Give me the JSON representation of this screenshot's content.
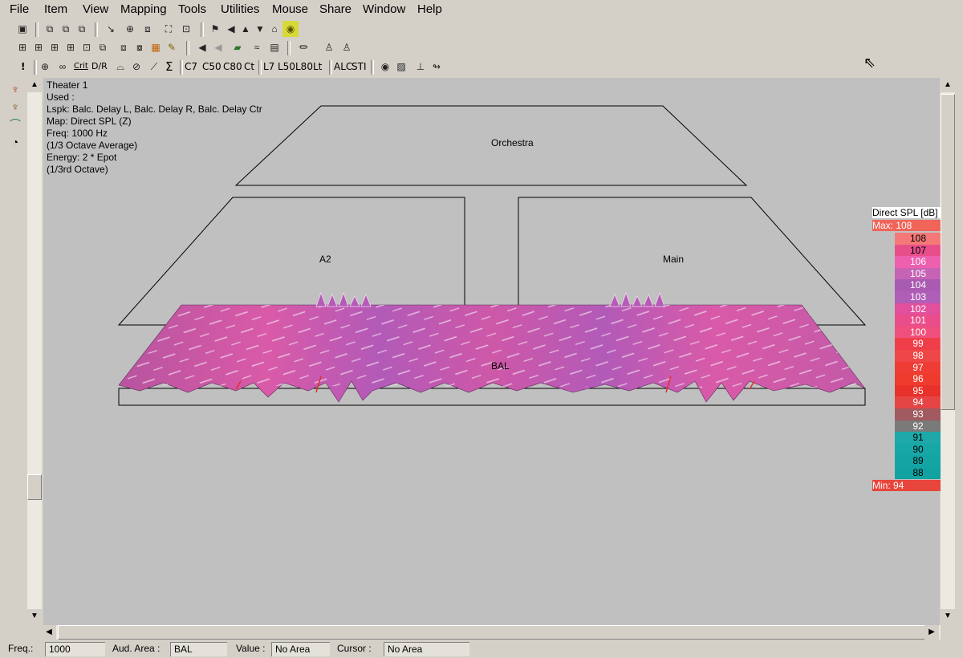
{
  "menu": [
    "File",
    "Item",
    "View",
    "Mapping",
    "Tools",
    "Utilities",
    "Mouse",
    "Share",
    "Window",
    "Help"
  ],
  "toolbar3_labels": [
    "!",
    "Σ",
    "C7",
    "C50",
    "C80",
    "Ct",
    "L7",
    "L50",
    "L80",
    "Lt",
    "ALC",
    "STI"
  ],
  "info": {
    "line1": "Theater 1",
    "line2": "Used :",
    "line3": "Lspk: Balc. Delay L, Balc. Delay R, Balc. Delay Ctr",
    "line4": "Map: Direct SPL (Z)",
    "line5": "Freq: 1000 Hz",
    "line6": "(1/3 Octave Average)",
    "line7": "Energy: 2 * Epot",
    "line8": "(1/3rd Octave)"
  },
  "regions": {
    "orchestra": "Orchestra",
    "a2": "A2",
    "main": "Main",
    "bal": "BAL"
  },
  "legend": {
    "title": "Direct SPL [dB]",
    "max_label": "Max: 108",
    "min_label": "Min: 94",
    "values": [
      "108",
      "107",
      "106",
      "105",
      "104",
      "103",
      "102",
      "101",
      "100",
      "99",
      "98",
      "97",
      "96",
      "95",
      "94",
      "93",
      "92",
      "91",
      "90",
      "89",
      "88"
    ],
    "colors": [
      "#f47878",
      "#e84f8a",
      "#ee5fae",
      "#c763b5",
      "#a95ab1",
      "#b05fb8",
      "#e24f9c",
      "#ea4d8a",
      "#ef4f7c",
      "#ef3e4a",
      "#ef4747",
      "#ef3c35",
      "#ef3b2e",
      "#e8312a",
      "#e64545",
      "#a05a60",
      "#7a7a7a",
      "#1ea8a8",
      "#16a8a6",
      "#14a4a4",
      "#12a2a2"
    ],
    "text_colors": [
      "#000",
      "#000",
      "#fff",
      "#fff",
      "#fff",
      "#fff",
      "#fff",
      "#fff",
      "#fff",
      "#fff",
      "#fff",
      "#fff",
      "#fff",
      "#fff",
      "#fff",
      "#fff",
      "#fff",
      "#000",
      "#000",
      "#000",
      "#000"
    ]
  },
  "status": {
    "freq_label": "Freq.:",
    "freq_value": "1000",
    "area_label": "Aud. Area :",
    "area_value": "BAL",
    "value_label": "Value :",
    "value_value": "No Area",
    "cursor_label": "Cursor :",
    "cursor_value": "No Area"
  }
}
